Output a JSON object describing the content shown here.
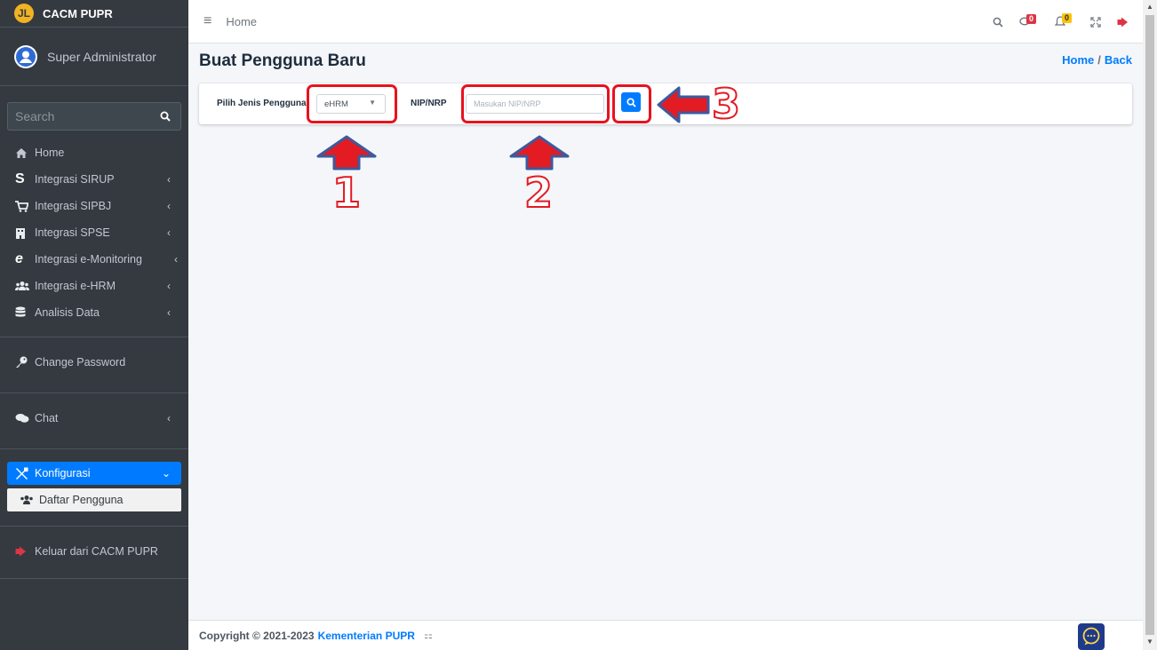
{
  "brand": {
    "title": "CACM PUPR",
    "logo_letter": "JL"
  },
  "user": {
    "name": "Super Administrator"
  },
  "sidebar": {
    "search_placeholder": "Search",
    "items": [
      {
        "label": "Home",
        "icon": "home-icon"
      },
      {
        "label": "Integrasi SIRUP",
        "icon": "dollar-icon"
      },
      {
        "label": "Integrasi SIPBJ",
        "icon": "cart-icon"
      },
      {
        "label": "Integrasi SPSE",
        "icon": "building-icon"
      },
      {
        "label": "Integrasi e-Monitoring",
        "icon": "browser-e-icon"
      },
      {
        "label": "Integrasi e-HRM",
        "icon": "users-icon"
      },
      {
        "label": "Analisis Data",
        "icon": "database-icon"
      }
    ],
    "change_password": "Change Password",
    "chat": "Chat",
    "konfigurasi": "Konfigurasi",
    "daftar_pengguna": "Daftar Pengguna",
    "logout": "Keluar dari CACM PUPR"
  },
  "topbar": {
    "home_label": "Home",
    "chat_badge": "0",
    "notif_badge": "0"
  },
  "page": {
    "title": "Buat Pengguna Baru",
    "breadcrumb_home": "Home",
    "breadcrumb_sep": "/",
    "breadcrumb_back": "Back"
  },
  "form": {
    "jenis_label": "Pilih Jenis Pengguna",
    "jenis_selected": "eHRM",
    "nip_label": "NIP/NRP",
    "nip_placeholder": "Masukan NIP/NRP"
  },
  "annotations": {
    "n1": "1",
    "n2": "2",
    "n3": "3"
  },
  "footer": {
    "copyright": "Copyright © 2021-2023",
    "org": "Kementerian PUPR"
  },
  "colors": {
    "sidebar": "#343a40",
    "accent": "#007bff",
    "annotation": "#e8121e",
    "arrow": "#3d5a9e"
  }
}
